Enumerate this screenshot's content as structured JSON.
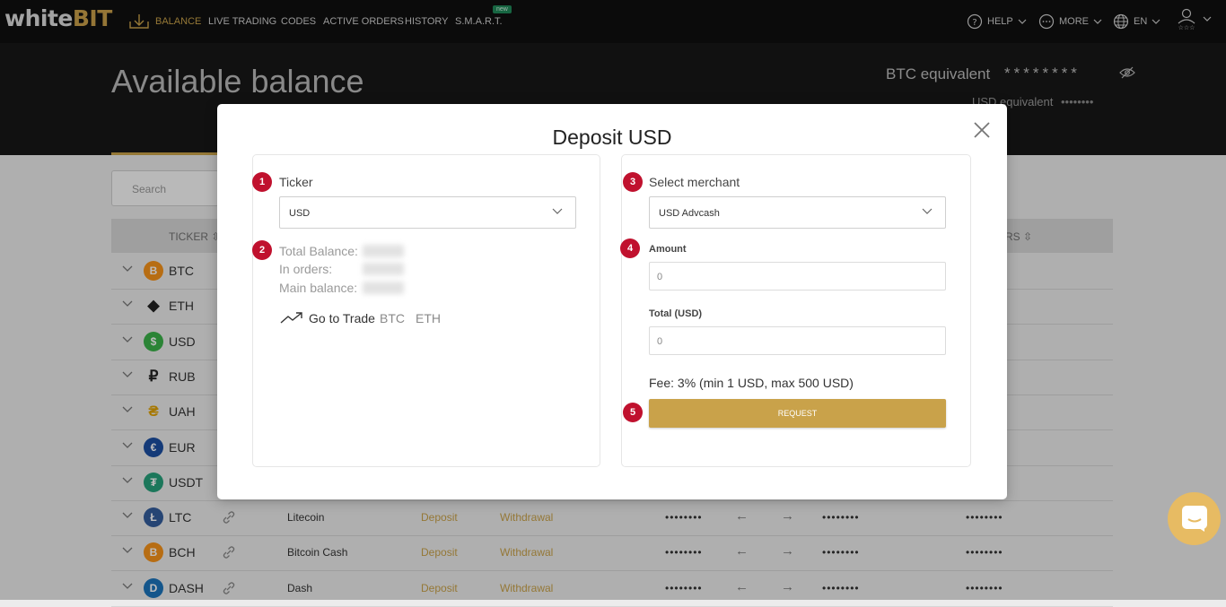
{
  "brand": {
    "part1": "white",
    "part2": "BIT",
    "accent": "#c9a24a"
  },
  "nav": {
    "items": [
      {
        "label": "BALANCE",
        "icon": "download-tray-icon",
        "active": true
      },
      {
        "label": "LIVE TRADING"
      },
      {
        "label": "CODES"
      },
      {
        "label": "ACTIVE ORDERS"
      },
      {
        "label": "HISTORY"
      },
      {
        "label": "S.M.A.R.T.",
        "badge": "new"
      }
    ],
    "right": [
      {
        "label": "HELP",
        "icon": "question-circle-icon"
      },
      {
        "label": "MORE",
        "icon": "more-circle-icon"
      },
      {
        "label": "EN",
        "icon": "globe-icon"
      },
      {
        "label": "",
        "icon": "user-stars-icon"
      }
    ]
  },
  "header": {
    "title": "Available balance",
    "btc_label": "BTC equivalent",
    "btc_value": "********",
    "usd_label": "USD equivalent",
    "usd_value": "••••••••"
  },
  "table": {
    "search_placeholder": "Search",
    "col_ticker": "TICKER",
    "col_orders": "RS",
    "rows": [
      {
        "ticker": "BTC",
        "icon": "bitcoin-icon",
        "color": "#f7931a",
        "glyph": "B"
      },
      {
        "ticker": "ETH",
        "icon": "ethereum-icon",
        "color": "#222222",
        "glyph": "◆"
      },
      {
        "ticker": "USD",
        "icon": "dollar-icon",
        "color": "#3bb24a",
        "glyph": "$"
      },
      {
        "ticker": "RUB",
        "icon": "ruble-icon",
        "color": "#222222",
        "glyph": "₽"
      },
      {
        "ticker": "UAH",
        "icon": "hryvnia-icon",
        "color": "#e0a100",
        "glyph": "₴"
      },
      {
        "ticker": "EUR",
        "icon": "euro-icon",
        "color": "#1b4fa3",
        "glyph": "€"
      },
      {
        "ticker": "USDT",
        "icon": "tether-icon",
        "color": "#26a17b",
        "glyph": "₮"
      },
      {
        "ticker": "LTC",
        "icon": "litecoin-icon",
        "color": "#345d9d",
        "glyph": "Ł",
        "name": "Litecoin",
        "deposit": "Deposit",
        "withdrawal": "Withdrawal",
        "v1": "••••••••",
        "v2": "••••••••",
        "v3": "••••••••"
      },
      {
        "ticker": "BCH",
        "icon": "bitcoin-cash-icon",
        "color": "#f7931a",
        "glyph": "B",
        "name": "Bitcoin Cash",
        "deposit": "Deposit",
        "withdrawal": "Withdrawal",
        "v1": "••••••••",
        "v2": "••••••••",
        "v3": "••••••••"
      },
      {
        "ticker": "DASH",
        "icon": "dash-icon",
        "color": "#1c75bc",
        "glyph": "D",
        "name": "Dash",
        "deposit": "Deposit",
        "withdrawal": "Withdrawal",
        "v1": "••••••••",
        "v2": "••••••••",
        "v3": "••••••••"
      }
    ]
  },
  "modal": {
    "title": "Deposit USD",
    "left": {
      "step1": "1",
      "ticker_label": "Ticker",
      "ticker_value": "USD",
      "step2": "2",
      "total_balance_label": "Total Balance:",
      "in_orders_label": "In orders:",
      "main_balance_label": "Main balance:",
      "goto_label": "Go to Trade",
      "goto_links": [
        "BTC",
        "ETH"
      ]
    },
    "right": {
      "step3": "3",
      "merchant_label": "Select merchant",
      "merchant_value": "USD Advcash",
      "step4": "4",
      "amount_label": "Amount",
      "amount_value": "0",
      "total_label": "Total (USD)",
      "total_value": "0",
      "fee_text": "Fee: 3% (min 1 USD, max 500 USD)",
      "step5": "5",
      "request_label": "REQUEST"
    }
  }
}
